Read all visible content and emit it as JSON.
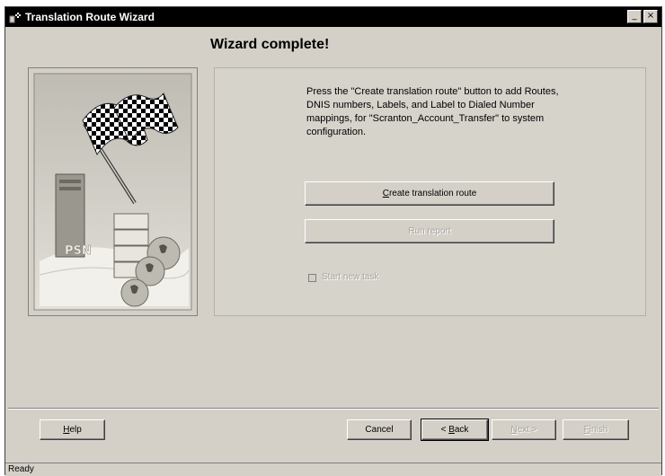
{
  "window": {
    "title": "Translation Route Wizard",
    "min_glyph": "_",
    "close_glyph": "×"
  },
  "heading": "Wizard complete!",
  "illustration": {
    "psn_label": "PSN"
  },
  "description": "Press the \"Create translation route\" button to add Routes, DNIS numbers, Labels, and Label to Dialed Number mappings, for \"Scranton_Account_Transfer\" to system configuration.",
  "actions": {
    "create_label": "Create translation route",
    "create_mnemonic": "C",
    "create_rest": "reate translation route",
    "second_label": "Run report"
  },
  "checkbox": {
    "label": "Start new task",
    "checked": false
  },
  "footer": {
    "help_mnemonic": "H",
    "help_rest": "elp",
    "cancel": "Cancel",
    "back_prefix": "< ",
    "back_mnemonic": "B",
    "back_rest": "ack",
    "next_mnemonic": "N",
    "next_rest": "ext >",
    "finish_mnemonic": "F",
    "finish_rest": "inish"
  },
  "status": {
    "text": "Ready"
  },
  "colors": {
    "face": "#d4d0c8",
    "titlebar": "#000000",
    "disabled_text": "#a8a59e"
  }
}
